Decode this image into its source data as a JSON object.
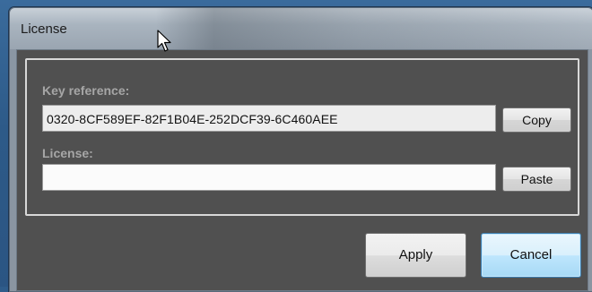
{
  "window": {
    "title": "License"
  },
  "key_section": {
    "label": "Key reference:",
    "value": "0320-8CF589EF-82F1B04E-252DCF39-6C460AEE",
    "copy_label": "Copy"
  },
  "license_section": {
    "label": "License:",
    "value": "",
    "paste_label": "Paste"
  },
  "actions": {
    "apply_label": "Apply",
    "cancel_label": "Cancel"
  },
  "colors": {
    "client_background": "#505050",
    "default_button_accent": "#3c7fb1"
  }
}
